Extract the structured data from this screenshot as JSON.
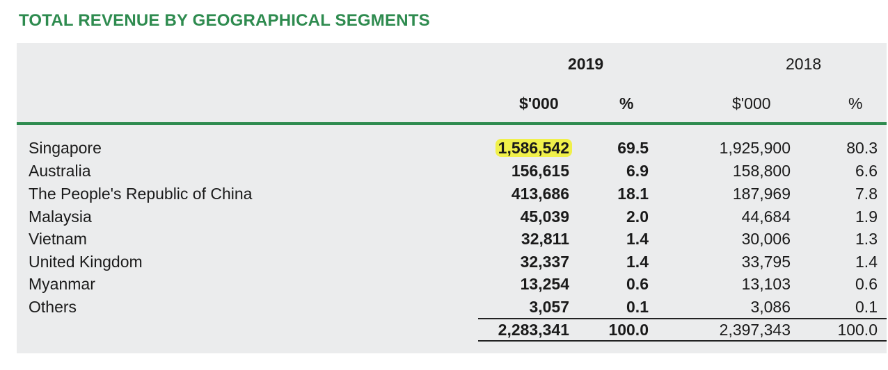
{
  "title": "TOTAL REVENUE BY GEOGRAPHICAL SEGMENTS",
  "header": {
    "year_2019": "2019",
    "year_2018": "2018",
    "unit_2019": "$'000",
    "pct_2019": "%",
    "unit_2018": "$'000",
    "pct_2018": "%"
  },
  "rows": [
    {
      "country": "Singapore",
      "v2019": "1,586,542",
      "p2019": "69.5",
      "v2018": "1,925,900",
      "p2018": "80.3",
      "highlighted": true
    },
    {
      "country": "Australia",
      "v2019": "156,615",
      "p2019": "6.9",
      "v2018": "158,800",
      "p2018": "6.6"
    },
    {
      "country": "The People's Republic of China",
      "v2019": "413,686",
      "p2019": "18.1",
      "v2018": "187,969",
      "p2018": "7.8"
    },
    {
      "country": "Malaysia",
      "v2019": "45,039",
      "p2019": "2.0",
      "v2018": "44,684",
      "p2018": "1.9"
    },
    {
      "country": "Vietnam",
      "v2019": "32,811",
      "p2019": "1.4",
      "v2018": "30,006",
      "p2018": "1.3"
    },
    {
      "country": "United Kingdom",
      "v2019": "32,337",
      "p2019": "1.4",
      "v2018": "33,795",
      "p2018": "1.4"
    },
    {
      "country": "Myanmar",
      "v2019": "13,254",
      "p2019": "0.6",
      "v2018": "13,103",
      "p2018": "0.6"
    },
    {
      "country": "Others",
      "v2019": "3,057",
      "p2019": "0.1",
      "v2018": "3,086",
      "p2018": "0.1"
    }
  ],
  "total": {
    "v2019": "2,283,341",
    "p2019": "100.0",
    "v2018": "2,397,343",
    "p2018": "100.0"
  },
  "colors": {
    "accent": "#2e8b4f",
    "panel": "#ebeced",
    "highlight": "#f0f04a"
  }
}
